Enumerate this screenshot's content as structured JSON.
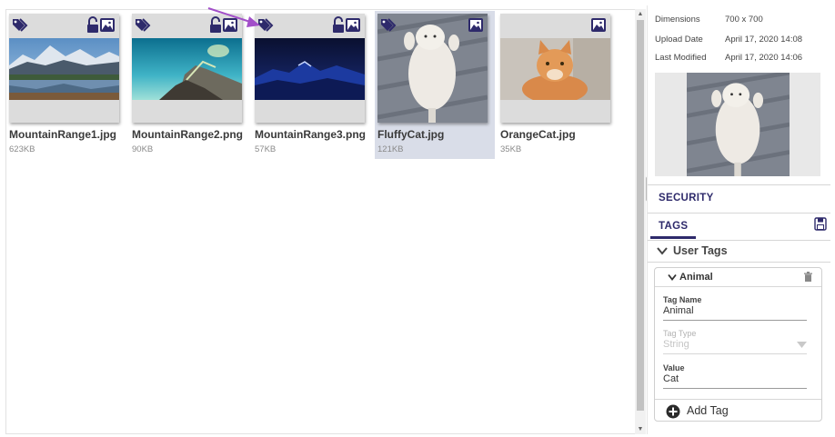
{
  "gallery": {
    "items": [
      {
        "name": "MountainRange1.jpg",
        "size": "623KB",
        "selected": false,
        "icons": [
          "tag-icon",
          "lock-icon",
          "image-icon"
        ]
      },
      {
        "name": "MountainRange2.png",
        "size": "90KB",
        "selected": false,
        "icons": [
          "tag-icon",
          "lock-icon",
          "image-icon"
        ]
      },
      {
        "name": "MountainRange3.png",
        "size": "57KB",
        "selected": false,
        "icons": [
          "tag-icon",
          "lock-icon",
          "image-icon"
        ]
      },
      {
        "name": "FluffyCat.jpg",
        "size": "121KB",
        "selected": true,
        "icons": [
          "tag-icon",
          "image-icon"
        ]
      },
      {
        "name": "OrangeCat.jpg",
        "size": "35KB",
        "selected": false,
        "icons": [
          "image-icon"
        ]
      }
    ]
  },
  "details": {
    "dimensions_label": "Dimensions",
    "dimensions_value": "700 x 700",
    "upload_label": "Upload Date",
    "upload_value": "April 17, 2020 14:08",
    "modified_label": "Last Modified",
    "modified_value": "April 17, 2020 14:06"
  },
  "sections": {
    "security": "SECURITY",
    "tags": "TAGS",
    "user_tags": "User Tags"
  },
  "tag": {
    "title": "Animal",
    "name_label": "Tag Name",
    "name_value": "Animal",
    "type_label": "Tag Type",
    "type_value": "String",
    "value_label": "Value",
    "value_value": "Cat",
    "add_label": "Add Tag"
  },
  "colors": {
    "accent": "#2e2a6b",
    "arrow": "#a24fc9",
    "selected_bg": "#d9dde8"
  }
}
